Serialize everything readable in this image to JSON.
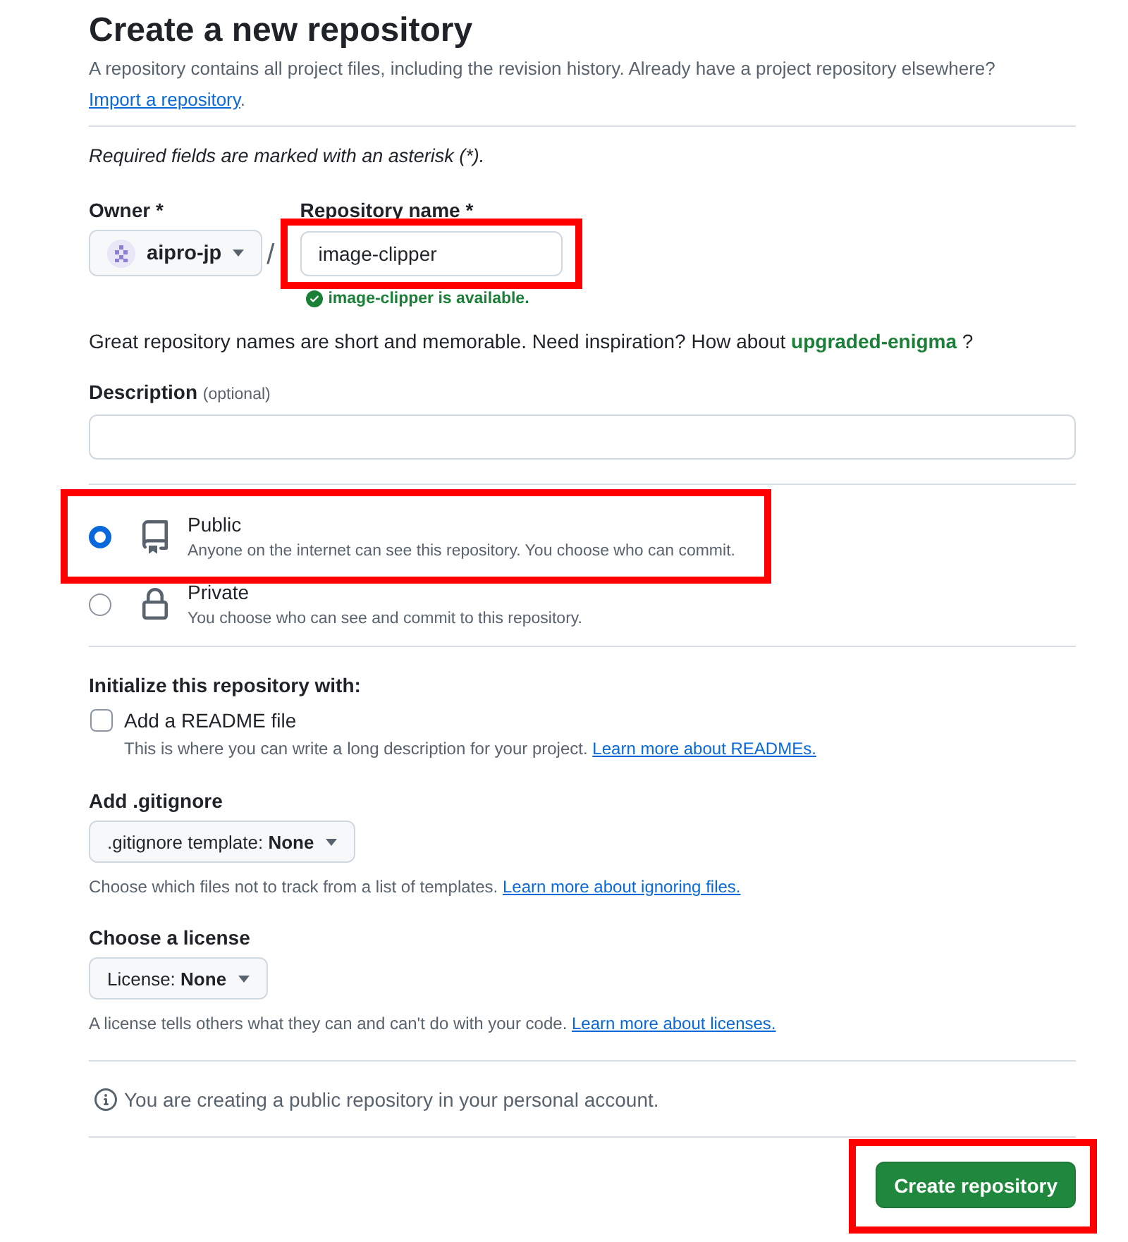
{
  "header": {
    "title": "Create a new repository",
    "intro": "A repository contains all project files, including the revision history. Already have a project repository elsewhere?",
    "import_link": "Import a repository",
    "after_link": "."
  },
  "required_note": "Required fields are marked with an asterisk (*).",
  "owner": {
    "label": "Owner *",
    "value": "aipro-jp"
  },
  "separator": "/",
  "repository_name": {
    "label": "Repository name *",
    "value": "image-clipper",
    "highlighted": true,
    "availability": {
      "available": true,
      "text": "image-clipper is available."
    }
  },
  "suggestion": {
    "text": "Great repository names are short and memorable. Need inspiration? How about",
    "name": "upgraded-enigma",
    "after": "?"
  },
  "description": {
    "label": "Description",
    "hint": "(optional)"
  },
  "visibility": {
    "options": [
      {
        "kind": "public",
        "label": "Public",
        "description": "Anyone on the internet can see this repository. You choose who can commit.",
        "selected": true,
        "highlighted": true
      },
      {
        "kind": "private",
        "label": "Private",
        "description": "You choose who can see and commit to this repository.",
        "selected": false,
        "highlighted": false
      }
    ]
  },
  "initialize": {
    "heading": "Initialize this repository with:",
    "readme": {
      "label": "Add a README file",
      "checked": false,
      "description": "This is where you can write a long description for your project.",
      "link": "Learn more about READMEs."
    }
  },
  "gitignore": {
    "heading": "Add .gitignore",
    "dropdown": {
      "label": ".gitignore template:",
      "value": "None"
    },
    "help": "Choose which files not to track from a list of templates.",
    "link": "Learn more about ignoring files."
  },
  "license": {
    "heading": "Choose a license",
    "dropdown": {
      "label": "License:",
      "value": "None"
    },
    "help": "A license tells others what they can and can't do with your code.",
    "link": "Learn more about licenses."
  },
  "notice": {
    "text": "You are creating a public repository in your personal account."
  },
  "submit": {
    "label": "Create repository",
    "highlighted": true
  }
}
